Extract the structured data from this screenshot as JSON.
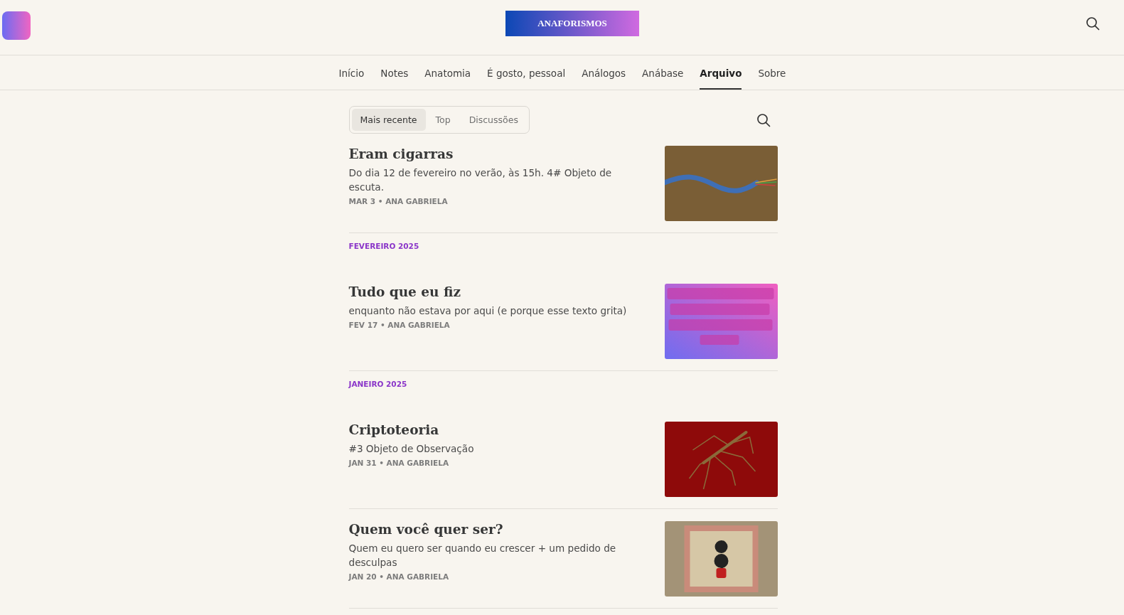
{
  "header": {
    "banner_title": "ANAFORISMOS"
  },
  "nav": [
    {
      "label": "Início",
      "selected": false
    },
    {
      "label": "Notes",
      "selected": false
    },
    {
      "label": "Anatomia",
      "selected": false
    },
    {
      "label": "É gosto, pessoal",
      "selected": false
    },
    {
      "label": "Análogos",
      "selected": false
    },
    {
      "label": "Anábase",
      "selected": false
    },
    {
      "label": "Arquivo",
      "selected": true
    },
    {
      "label": "Sobre",
      "selected": false
    }
  ],
  "sort_tabs": [
    {
      "label": "Mais recente",
      "selected": true
    },
    {
      "label": "Top",
      "selected": false
    },
    {
      "label": "Discussões",
      "selected": false
    }
  ],
  "feed": [
    {
      "kind": "post",
      "title": "Eram cigarras",
      "subtitle": "Do dia 12 de fevereiro no verão, às 15h. 4# Objeto de escuta.",
      "meta": "MAR 3 • ANA GABRIELA"
    },
    {
      "kind": "month",
      "label": "FEVEREIRO 2025"
    },
    {
      "kind": "post",
      "title": "Tudo que eu fiz",
      "subtitle": "enquanto não estava por aqui (e porque esse texto grita)",
      "meta": "FEV 17 • ANA GABRIELA"
    },
    {
      "kind": "month",
      "label": "JANEIRO 2025"
    },
    {
      "kind": "post",
      "title": "Criptoteoria",
      "subtitle": "#3 Objeto de Observação",
      "meta": "JAN 31 • ANA GABRIELA"
    },
    {
      "kind": "post",
      "title": "Quem você quer ser?",
      "subtitle": "Quem eu quero ser quando eu crescer + um pedido de desculpas",
      "meta": "JAN 20 • ANA GABRIELA"
    }
  ]
}
